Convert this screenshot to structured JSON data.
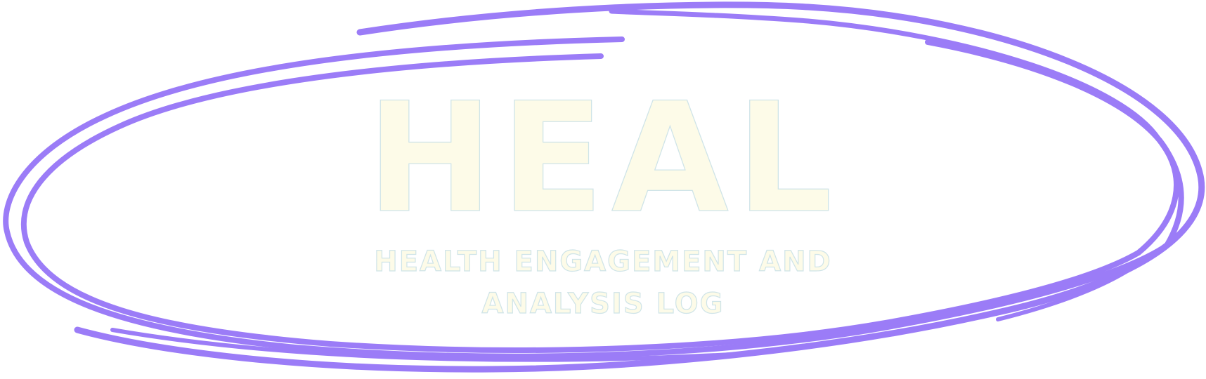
{
  "logo": {
    "wordmark": "HEAL",
    "tagline_line1": "HEALTH ENGAGEMENT AND",
    "tagline_line2": "ANALYSIS LOG"
  },
  "colors": {
    "loop_stroke": "#9b7cf7",
    "text_fill": "#fdfbe8",
    "text_outline": "#cfe4e8",
    "background": "#ffffff"
  }
}
